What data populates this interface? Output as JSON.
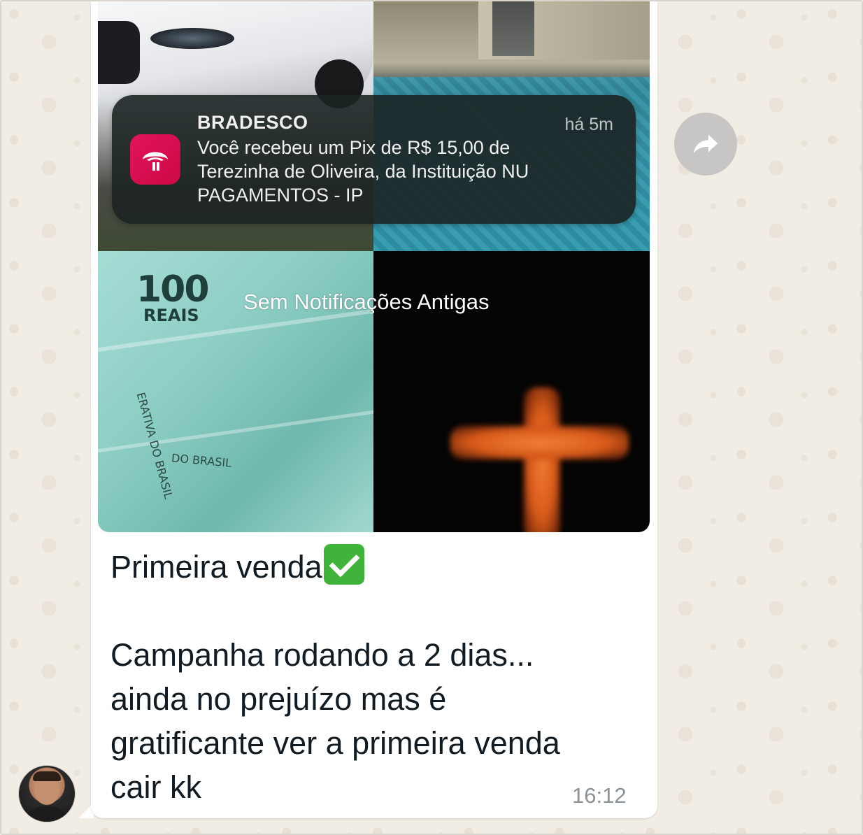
{
  "notification": {
    "app": "BRADESCO",
    "time": "há 5m",
    "body": "Você recebeu um Pix de R$ 15,00 de Terezinha de Oliveira, da Instituição NU PAGAMENTOS - IP",
    "icon": "bradesco-logo-icon"
  },
  "media": {
    "overlay_text": "Sem Notificações Antigas",
    "banknote_number": "100",
    "banknote_currency": "REAIS",
    "banknote_text_1": "ERATIVA DO BRASIL",
    "banknote_text_2": "DO BRASIL"
  },
  "message": {
    "caption_line1": "Primeira venda",
    "caption_emoji": "check-mark-button-emoji",
    "caption_rest": "Campanha rodando a 2 dias...\nainda no prejuízo mas é\ngratificante ver a primeira venda\ncair kk",
    "timestamp": "16:12"
  },
  "actions": {
    "forward_icon": "forward-arrow-icon"
  },
  "colors": {
    "bubble": "#ffffff",
    "wallpaper": "#efeae2",
    "bradesco_red": "#e2135b",
    "timestamp": "#8a9297",
    "check_green": "#3fb33a"
  }
}
